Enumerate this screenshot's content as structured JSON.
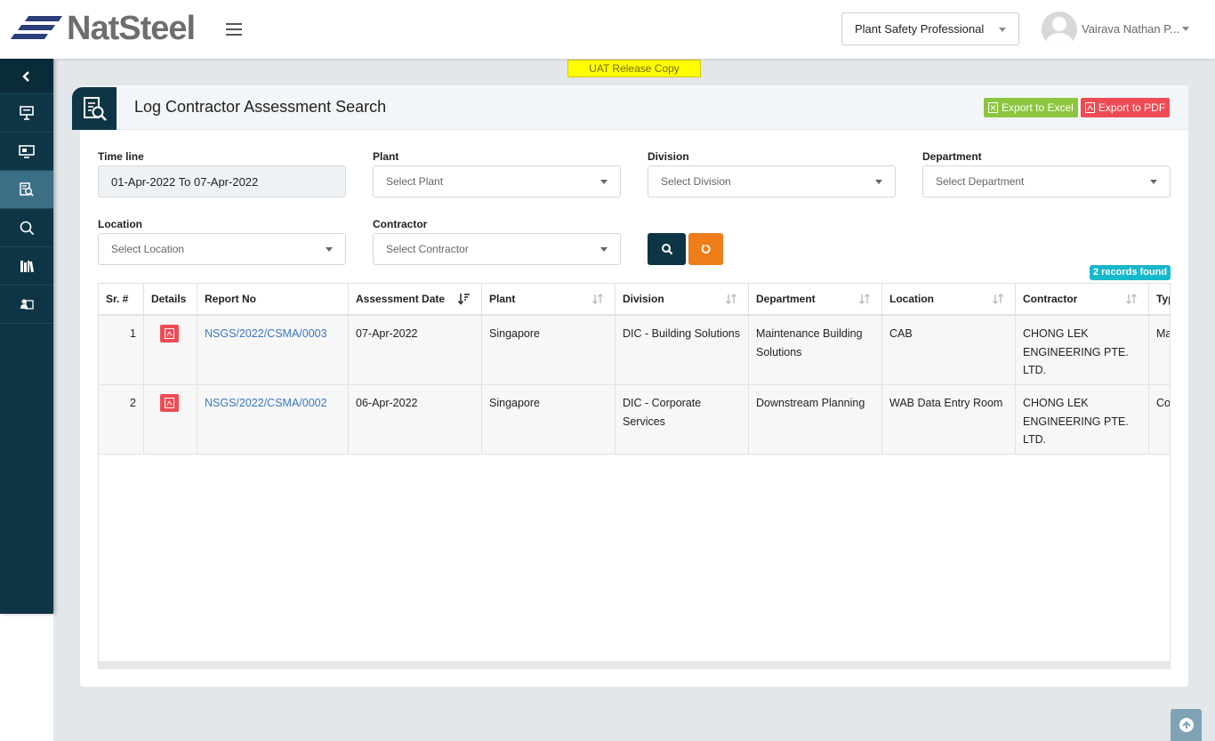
{
  "header": {
    "logo_text": "NatSteel",
    "role": "Plant Safety Professional",
    "user_name": "Vairava Nathan P..."
  },
  "banner": "UAT Release Copy",
  "page": {
    "title": "Log Contractor Assessment Search",
    "export_excel": "Export to Excel",
    "export_pdf": "Export to PDF"
  },
  "filters": {
    "timeline_label": "Time line",
    "timeline_value": "01-Apr-2022 To 07-Apr-2022",
    "plant_label": "Plant",
    "plant_placeholder": "Select Plant",
    "division_label": "Division",
    "division_placeholder": "Select Division",
    "department_label": "Department",
    "department_placeholder": "Select Department",
    "location_label": "Location",
    "location_placeholder": "Select Location",
    "contractor_label": "Contractor",
    "contractor_placeholder": "Select Contractor"
  },
  "records_found": "2 records found",
  "table": {
    "columns": [
      "Sr. #",
      "Details",
      "Report No",
      "Assessment Date",
      "Plant",
      "Division",
      "Department",
      "Location",
      "Contractor",
      "Typ"
    ],
    "rows": [
      {
        "sr": "1",
        "report_no": "NSGS/2022/CSMA/0003",
        "date": "07-Apr-2022",
        "plant": "Singapore",
        "division": "DIC - Building Solutions",
        "department": "Maintenance Building Solutions",
        "location": "CAB",
        "contractor": "CHONG LEK ENGINEERING PTE. LTD.",
        "type": "Ma"
      },
      {
        "sr": "2",
        "report_no": "NSGS/2022/CSMA/0002",
        "date": "06-Apr-2022",
        "plant": "Singapore",
        "division": "DIC - Corporate Services",
        "department": "Downstream Planning",
        "location": "WAB Data Entry Room",
        "contractor": "CHONG LEK ENGINEERING PTE. LTD.",
        "type": "Co"
      }
    ]
  },
  "colors": {
    "sidebar": "#0d3545",
    "accent_active": "#3a6f85",
    "excel": "#8cc63f",
    "pdf": "#ef4b55",
    "reset": "#ef7d1a",
    "badge": "#17b8c9"
  }
}
